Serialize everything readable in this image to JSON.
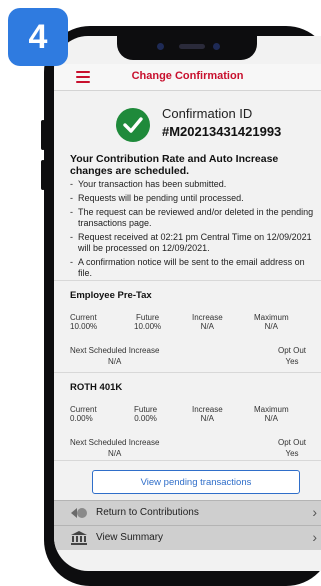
{
  "step_badge": "4",
  "header": {
    "title": "Change Confirmation"
  },
  "confirmation": {
    "label": "Confirmation ID",
    "id": "#M20213431421993"
  },
  "scheduled_text": "Your Contribution Rate and Auto Increase changes are scheduled.",
  "notes": [
    "Your transaction has been submitted.",
    "Requests will be pending until processed.",
    "The request can be reviewed and/or deleted in the pending transactions page.",
    "Request received at 02:21 pm Central Time on 12/09/2021 will be processed on 12/09/2021.",
    "A confirmation notice will be sent to the email address on file."
  ],
  "sections": [
    {
      "title": "Employee Pre-Tax",
      "current_label": "Current",
      "current_value": "10.00%",
      "future_label": "Future",
      "future_value": "10.00%",
      "increase_label": "Increase",
      "increase_value": "N/A",
      "maximum_label": "Maximum",
      "maximum_value": "N/A",
      "next_label": "Next Scheduled Increase",
      "next_value": "N/A",
      "optout_label": "Opt Out",
      "optout_value": "Yes"
    },
    {
      "title": "ROTH 401K",
      "current_label": "Current",
      "current_value": "0.00%",
      "future_label": "Future",
      "future_value": "0.00%",
      "increase_label": "Increase",
      "increase_value": "N/A",
      "maximum_label": "Maximum",
      "maximum_value": "N/A",
      "next_label": "Next Scheduled Increase",
      "next_value": "N/A",
      "optout_label": "Opt Out",
      "optout_value": "Yes"
    }
  ],
  "pending_button": "View pending transactions",
  "bottom": {
    "return_label": "Return to Contributions",
    "summary_label": "View Summary"
  },
  "colors": {
    "brand_red": "#c8102e",
    "badge_blue": "#2f7be0",
    "success_green": "#1f8a3b",
    "link_blue": "#2f6ec9"
  }
}
